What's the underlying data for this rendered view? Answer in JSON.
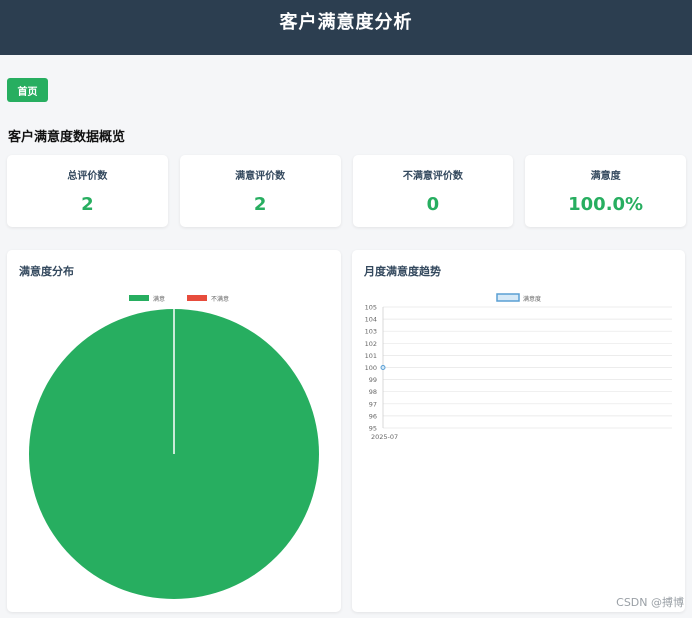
{
  "header": {
    "title": "客户满意度分析"
  },
  "nav": {
    "home_label": "首页"
  },
  "overview": {
    "title": "客户满意度数据概览",
    "cards": [
      {
        "label": "总评价数",
        "value": "2"
      },
      {
        "label": "满意评价数",
        "value": "2"
      },
      {
        "label": "不满意评价数",
        "value": "0"
      },
      {
        "label": "满意度",
        "value": "100.0%"
      }
    ]
  },
  "pie_panel": {
    "title": "满意度分布"
  },
  "line_panel": {
    "title": "月度满意度趋势"
  },
  "watermark": "CSDN @搏博",
  "colors": {
    "accent": "#27ae60",
    "header": "#2c3e50",
    "danger": "#e74c3c",
    "line": "#5a9fd4"
  },
  "chart_data": [
    {
      "type": "pie",
      "categories": [
        "满意",
        "不满意"
      ],
      "values": [
        2,
        0
      ],
      "colors": [
        "#27ae60",
        "#e74c3c"
      ],
      "legend": "top"
    },
    {
      "type": "line",
      "x": [
        "2025-07"
      ],
      "series": [
        {
          "name": "满意度",
          "values": [
            100
          ]
        }
      ],
      "ylim": [
        95,
        105
      ],
      "yticks": [
        105,
        104,
        103,
        102,
        101,
        100,
        99,
        98,
        97,
        96,
        95
      ],
      "grid": true,
      "legend": "top"
    }
  ]
}
